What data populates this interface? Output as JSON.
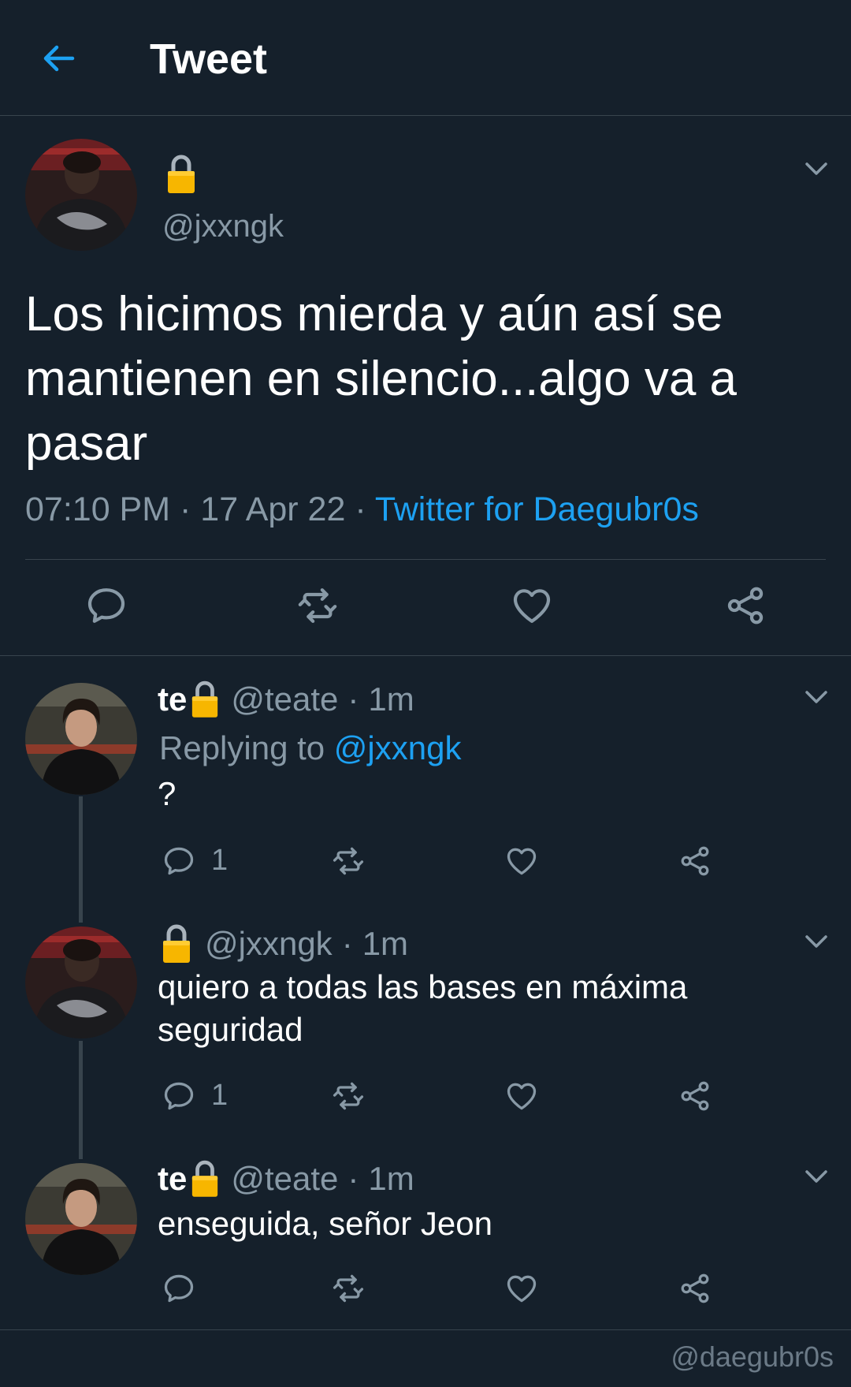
{
  "header": {
    "title": "Tweet",
    "back_icon": "arrow-left-icon"
  },
  "colors": {
    "background": "#15202b",
    "accent": "#1da1f2",
    "muted": "#8899a6",
    "divider": "#38444d",
    "lock": "#f7b600"
  },
  "main_tweet": {
    "handle": "@jxxngk",
    "text": "Los hicimos mierda y aún así se mantienen en silencio...algo va a pasar",
    "time": "07:10 PM",
    "date": "17 Apr 22",
    "sep": "·",
    "source": "Twitter for Daegubr0s"
  },
  "replies": [
    {
      "name": "te",
      "handle": "@teate",
      "time": "1m",
      "sep": "·",
      "replying_prefix": "Replying to",
      "replying_handle": "@jxxngk",
      "text": "?",
      "reply_count": "1"
    },
    {
      "handle": "@jxxngk",
      "time": "1m",
      "sep": "·",
      "text": "quiero a todas las bases en máxima seguridad",
      "reply_count": "1"
    },
    {
      "name": "te",
      "handle": "@teate",
      "time": "1m",
      "sep": "·",
      "text": "enseguida, señor Jeon"
    }
  ],
  "watermark": "@daegubr0s"
}
